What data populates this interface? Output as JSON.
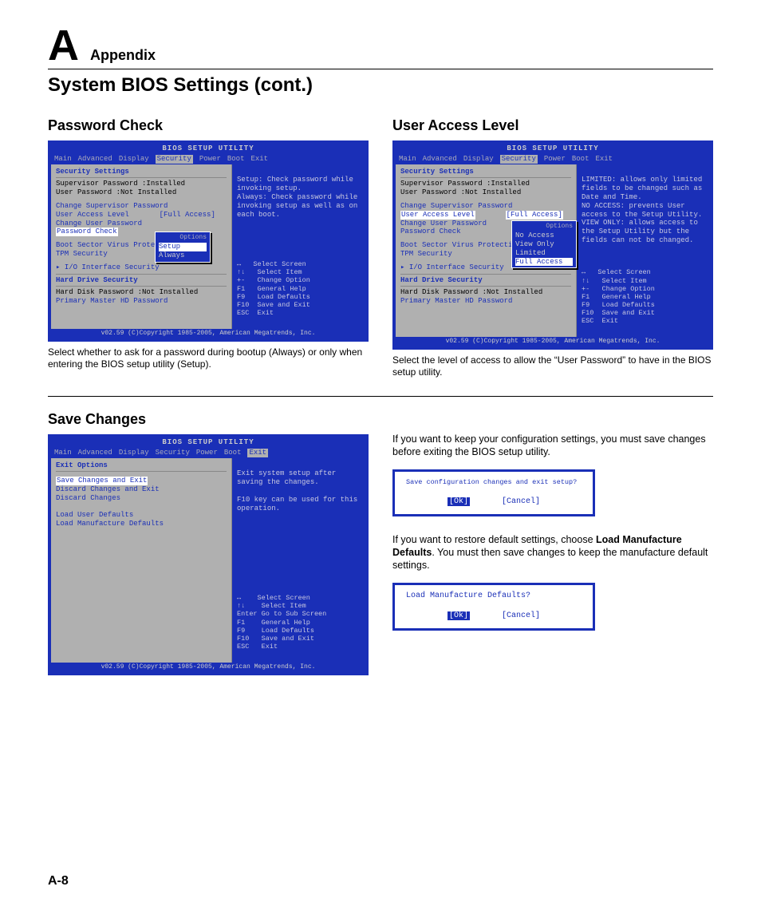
{
  "header": {
    "letter": "A",
    "label": "Appendix",
    "title": "System BIOS Settings (cont.)"
  },
  "bios_common": {
    "utility_title": "BIOS SETUP UTILITY",
    "tabs": [
      "Main",
      "Advanced",
      "Display",
      "Security",
      "Power",
      "Boot",
      "Exit"
    ],
    "footer": "v02.59 (C)Copyright 1985-2005, American Megatrends, Inc.",
    "nav_hints": "↔   Select Screen\n↑↓   Select Item\n+-   Change Option\nF1   General Help\nF9   Load Defaults\nF10  Save and Exit\nESC  Exit",
    "nav_hints_exit": "↔    Select Screen\n↑↓    Select Item\nEnter Go to Sub Screen\nF1    General Help\nF9    Load Defaults\nF10   Save and Exit\nESC   Exit"
  },
  "password_check": {
    "heading": "Password Check",
    "section_head": "Security Settings",
    "lines": {
      "sup_pw": "Supervisor Password  :Installed",
      "usr_pw": "User Password        :Not Installed",
      "chg_sup": "Change Supervisor Password",
      "ual_label": "User Access Level",
      "ual_val": "[Full Access]",
      "chg_usr": "Change User Password",
      "pw_check": "Password Check",
      "boot_sector": "Boot Sector Virus Protectio",
      "tpm": "TPM Security",
      "io_sec": "▸ I/O Interface Security",
      "hd_sec": "Hard Drive Security",
      "hd_pw": "Hard Disk Password   :Not Installed",
      "pri_hd": "Primary Master HD Password"
    },
    "popup": {
      "title": "Options",
      "opts": [
        "Setup",
        "Always"
      ],
      "selected": "Setup"
    },
    "help": "Setup: Check password while invoking setup.\nAlways: Check password while invoking setup as well as on each boot.",
    "caption": "Select whether to ask for a password during bootup (Always) or only when entering the BIOS setup utility (Setup)."
  },
  "user_access": {
    "heading": "User Access Level",
    "section_head": "Security Settings",
    "ual_val": "[Full Access]",
    "popup": {
      "title": "Options",
      "opts": [
        "No Access",
        "View Only",
        "Limited",
        "Full Access"
      ],
      "selected": "Full Access"
    },
    "help": "LIMITED: allows only limited fields to be changed such as Date and Time.\nNO ACCESS: prevents User access to the Setup Utility.\nVIEW ONLY: allows access to the Setup Utility but the fields can not be changed.",
    "caption": "Select the level of access to allow the “User Password” to have in the BIOS setup utility."
  },
  "save_changes": {
    "heading": "Save Changes",
    "section_head": "Exit Options",
    "items": [
      "Save Changes and Exit",
      "Discard Changes and Exit",
      "Discard Changes",
      "",
      "Load User Defaults",
      "Load Manufacture Defaults"
    ],
    "help": "Exit system setup after saving the changes.\n\nF10 key can be used for this operation.",
    "right_para1": "If you want to keep your configuration settings, you must save changes before exiting the BIOS setup utility.",
    "right_para2a": "If you want to restore default settings, choose ",
    "right_para2b": "Load Manufacture Defaults",
    "right_para2c": ". You must then save changes to keep the manufacture default settings.",
    "dialog1": {
      "q": "Save configuration changes and exit setup?",
      "ok": "[Ok]",
      "cancel": "[Cancel]"
    },
    "dialog2": {
      "q": "Load Manufacture Defaults?",
      "ok": "[Ok]",
      "cancel": "[Cancel]"
    }
  },
  "page_num": "A-8"
}
